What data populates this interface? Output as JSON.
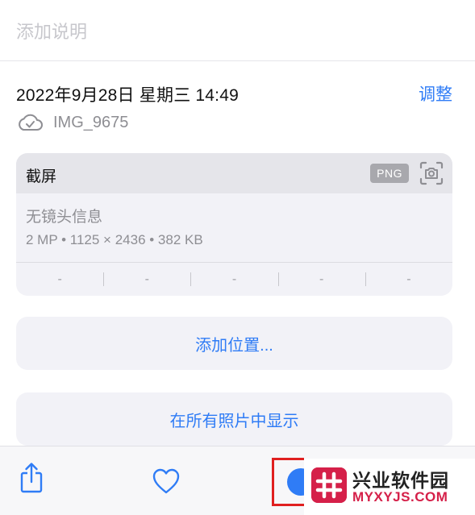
{
  "caption": {
    "placeholder": "添加说明"
  },
  "info": {
    "date": "2022年9月28日 星期三 14:49",
    "adjust_label": "调整",
    "filename": "IMG_9675",
    "cloud_icon": "cloud-check-icon"
  },
  "metadata": {
    "title": "截屏",
    "format_badge": "PNG",
    "camera_icon": "screenshot-camera-icon",
    "lens_info": "无镜头信息",
    "dimensions": "2 MP  •  1125 × 2436  •  382 KB",
    "exif": [
      "-",
      "-",
      "-",
      "-",
      "-"
    ]
  },
  "actions": {
    "add_location": "添加位置...",
    "show_in_all_photos": "在所有照片中显示"
  },
  "toolbar": {
    "share_icon": "share-icon",
    "favorite_icon": "heart-icon",
    "info_icon": "info-icon",
    "highlight_color": "#e02020"
  },
  "watermark": {
    "title": "兴业软件园",
    "url": "MYXYJS.COM",
    "brand_color": "#d52049"
  },
  "colors": {
    "accent": "#2f7cf6",
    "card_background": "#f2f2f7",
    "secondary_text": "#8e8e93"
  }
}
